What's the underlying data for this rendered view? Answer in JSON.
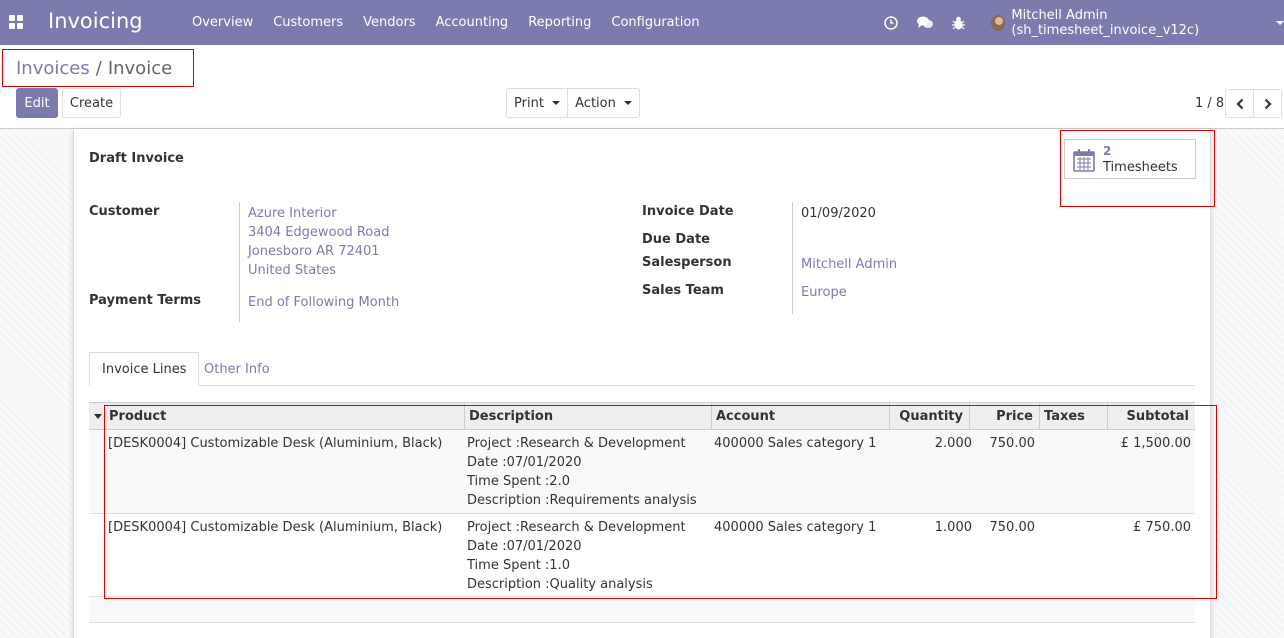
{
  "navbar": {
    "brand": "Invoicing",
    "menu": [
      "Overview",
      "Customers",
      "Vendors",
      "Accounting",
      "Reporting",
      "Configuration"
    ],
    "user": "Mitchell Admin (sh_timesheet_invoice_v12c)",
    "icons": [
      "clock-icon",
      "chat-icon",
      "bug-icon"
    ]
  },
  "breadcrumb": {
    "parent": "Invoices",
    "separator": "/",
    "current": "Invoice"
  },
  "toolbar": {
    "edit": "Edit",
    "create": "Create",
    "print": "Print",
    "action": "Action",
    "pager": "1 / 8"
  },
  "form": {
    "status_title": "Draft Invoice",
    "smart_button": {
      "count": "2",
      "label": "Timesheets"
    },
    "customer_label": "Customer",
    "customer_lines": [
      "Azure Interior",
      "3404 Edgewood Road",
      "Jonesboro AR 72401",
      "United States"
    ],
    "payment_terms_label": "Payment Terms",
    "payment_terms": "End of Following Month",
    "invoice_date_label": "Invoice Date",
    "invoice_date": "01/09/2020",
    "due_date_label": "Due Date",
    "salesperson_label": "Salesperson",
    "salesperson": "Mitchell Admin",
    "sales_team_label": "Sales Team",
    "sales_team": "Europe"
  },
  "tabs": [
    "Invoice Lines",
    "Other Info"
  ],
  "table": {
    "columns": [
      "Product",
      "Description",
      "Account",
      "Quantity",
      "Price",
      "Taxes",
      "Subtotal"
    ],
    "rows": [
      {
        "product": "[DESK0004] Customizable Desk (Aluminium, Black)",
        "description": [
          "Project :Research & Development",
          "Date :07/01/2020",
          "Time Spent :2.0",
          "Description :Requirements analysis"
        ],
        "account": "400000 Sales category 1",
        "quantity": "2.000",
        "price": "750.00",
        "taxes": "",
        "subtotal": "£ 1,500.00"
      },
      {
        "product": "[DESK0004] Customizable Desk (Aluminium, Black)",
        "description": [
          "Project :Research & Development",
          "Date :07/01/2020",
          "Time Spent :1.0",
          "Description :Quality analysis"
        ],
        "account": "400000 Sales category 1",
        "quantity": "1.000",
        "price": "750.00",
        "taxes": "",
        "subtotal": "£ 750.00"
      }
    ]
  },
  "colors": {
    "brand": "#7c7bad",
    "highlight": "#e00000"
  }
}
